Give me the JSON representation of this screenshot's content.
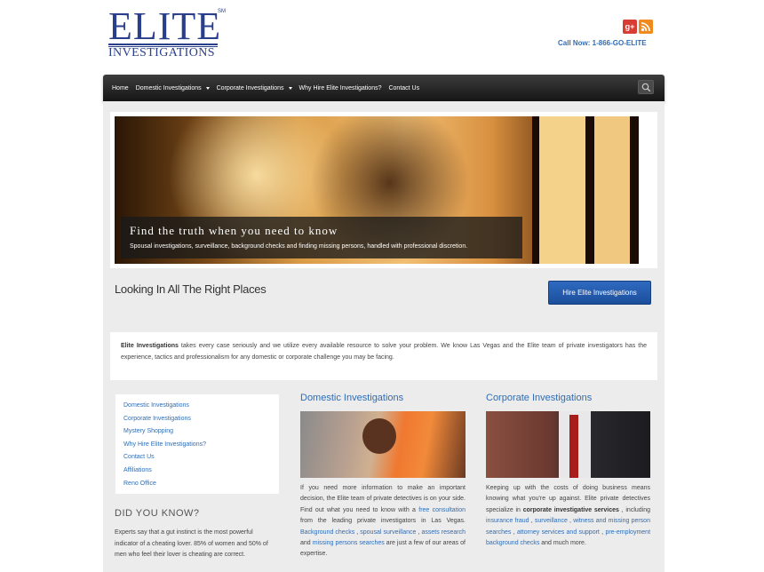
{
  "header": {
    "logo_main": "ELITE",
    "logo_sub": "INVESTIGATIONS",
    "logo_mark": "SM",
    "social": [
      "google-plus-icon",
      "rss-icon"
    ],
    "call_now": "Call Now: 1-866-GO-ELITE"
  },
  "nav": {
    "items": [
      {
        "label": "Home",
        "dropdown": false
      },
      {
        "label": "Domestic Investigations",
        "dropdown": true
      },
      {
        "label": "Corporate Investigations",
        "dropdown": true
      },
      {
        "label": "Why Hire Elite Investigations?",
        "dropdown": false
      },
      {
        "label": "Contact Us",
        "dropdown": false
      }
    ],
    "search_icon": "search-icon"
  },
  "hero": {
    "title": "Find the truth when you need to know",
    "text": "Spousal investigations, surveillance, background checks and finding missing persons, handled with professional discretion."
  },
  "main": {
    "heading": "Looking In All The Right Places",
    "cta_label": "Hire Elite Investigations",
    "intro_bold": "Elite Investigations",
    "intro_text": " takes every case seriously and we utilize every available resource to solve your problem. We know Las Vegas and the Elite team of private investigators has the experience, tactics and professionalism for any domestic or corporate challenge you may be facing."
  },
  "sidebar": {
    "links": [
      "Domestic Investigations",
      "Corporate Investigations",
      "Mystery Shopping",
      "Why Hire Elite Investigations?",
      "Contact Us",
      "Affiliations",
      "Reno Office"
    ],
    "dyk_title": "DID YOU KNOW?",
    "dyk_text": "Experts say that a gut instinct is the most powerful indicator of a cheating lover. 85% of women and 50% of men who feel their lover is cheating are correct."
  },
  "domestic": {
    "title": "Domestic Investigations",
    "t1": "If you need more information to make an important decision, the Elite team of private detectives is on your side. Find out what you need to know with a ",
    "l1": "free consultation",
    "t2": " from the leading private investigators in Las Vegas. ",
    "l2": "Background checks",
    "t3": " , ",
    "l3": "spousal surveillance",
    "t4": " , ",
    "l4": "assets research",
    "t5": " and ",
    "l5": "missing persons searches",
    "t6": " are just a few of our areas of expertise."
  },
  "corporate": {
    "title": "Corporate Investigations",
    "t1": "Keeping up with the costs of doing business means knowing what you're up against. Elite private detectives specialize in ",
    "b1": "corporate investigative services",
    "t2": " , including ",
    "l1": "insurance fraud",
    "t3": " , ",
    "l2": "surveillance",
    "t4": " , ",
    "l3": "witness and missing person searches",
    "t5": " , ",
    "l4": "attorney services and support",
    "t6": " , ",
    "l5": "pre-employment background checks",
    "t7": " and much more."
  },
  "colors": {
    "brand_blue": "#2a3f8c",
    "link_blue": "#2f6db5",
    "nav_dark": "#1e1e1e",
    "cta_blue": "#1f58a8"
  }
}
